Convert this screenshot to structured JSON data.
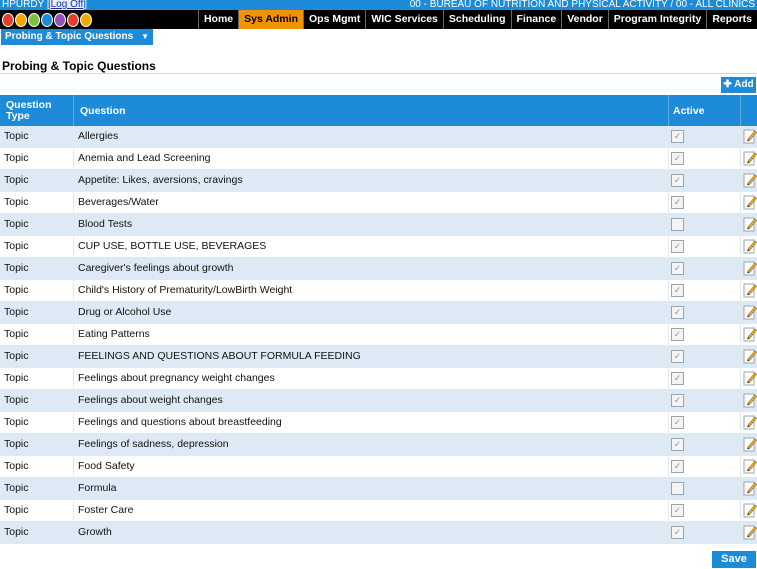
{
  "header": {
    "user": "HPURDY",
    "logoff_label": "Log Off",
    "agency": "00 - BUREAU OF NUTRITION AND PHYSICAL ACTIVITY / 00 - ALL CLINICS"
  },
  "nav": {
    "tabs": [
      {
        "label": "Home",
        "active": false
      },
      {
        "label": "Sys Admin",
        "active": true
      },
      {
        "label": "Ops Mgmt",
        "active": false
      },
      {
        "label": "WIC Services",
        "active": false
      },
      {
        "label": "Scheduling",
        "active": false
      },
      {
        "label": "Finance",
        "active": false
      },
      {
        "label": "Vendor",
        "active": false
      },
      {
        "label": "Program Integrity",
        "active": false
      },
      {
        "label": "Reports",
        "active": false
      }
    ]
  },
  "menu": {
    "current": "Probing & Topic Questions"
  },
  "page": {
    "title": "Probing & Topic Questions",
    "add_label": "Add",
    "save_label": "Save"
  },
  "table": {
    "headers": {
      "type": "Question Type",
      "question": "Question",
      "active": "Active"
    },
    "rows": [
      {
        "type": "Topic",
        "question": "Allergies",
        "active": true
      },
      {
        "type": "Topic",
        "question": "Anemia and Lead Screening",
        "active": true
      },
      {
        "type": "Topic",
        "question": "Appetite: Likes, aversions, cravings",
        "active": true
      },
      {
        "type": "Topic",
        "question": "Beverages/Water",
        "active": true
      },
      {
        "type": "Topic",
        "question": "Blood Tests",
        "active": false
      },
      {
        "type": "Topic",
        "question": "CUP USE, BOTTLE USE, BEVERAGES",
        "active": true
      },
      {
        "type": "Topic",
        "question": "Caregiver's feelings about growth",
        "active": true
      },
      {
        "type": "Topic",
        "question": "Child's History of Prematurity/LowBirth Weight",
        "active": true
      },
      {
        "type": "Topic",
        "question": "Drug or Alcohol Use",
        "active": true
      },
      {
        "type": "Topic",
        "question": "Eating Patterns",
        "active": true
      },
      {
        "type": "Topic",
        "question": "FEELINGS AND QUESTIONS ABOUT FORMULA FEEDING",
        "active": true
      },
      {
        "type": "Topic",
        "question": "Feelings about pregnancy weight changes",
        "active": true
      },
      {
        "type": "Topic",
        "question": "Feelings about weight changes",
        "active": true
      },
      {
        "type": "Topic",
        "question": "Feelings and questions about breastfeeding",
        "active": true
      },
      {
        "type": "Topic",
        "question": "Feelings of sadness, depression",
        "active": true
      },
      {
        "type": "Topic",
        "question": "Food Safety",
        "active": true
      },
      {
        "type": "Topic",
        "question": "Formula",
        "active": false
      },
      {
        "type": "Topic",
        "question": "Foster Care",
        "active": true
      },
      {
        "type": "Topic",
        "question": "Growth",
        "active": true
      }
    ]
  },
  "colors": {
    "accent": "#1e8bd8",
    "nav_active": "#f39200",
    "row_alt": "#ddeaf6"
  }
}
